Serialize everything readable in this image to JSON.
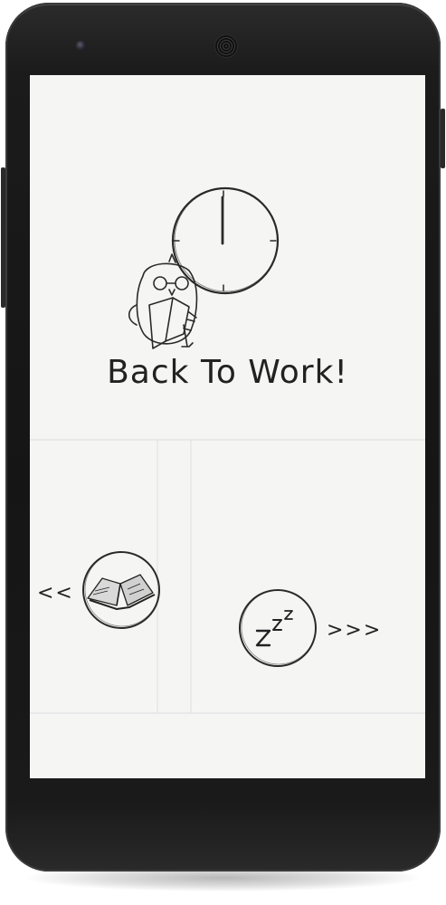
{
  "screen": {
    "title": "Back To Work!"
  },
  "navigation": {
    "left_chevrons": "<<",
    "right_chevrons": ">>>",
    "left_action_icon": "open-book-icon",
    "right_action_icon": "sleep-zzz-icon"
  },
  "illustration": {
    "icons": [
      "clock-icon",
      "owl-reading-book-icon"
    ]
  },
  "colors": {
    "screen_background": "#f5f5f4",
    "ink": "#222222",
    "phone_body": "#1b1b1b"
  }
}
